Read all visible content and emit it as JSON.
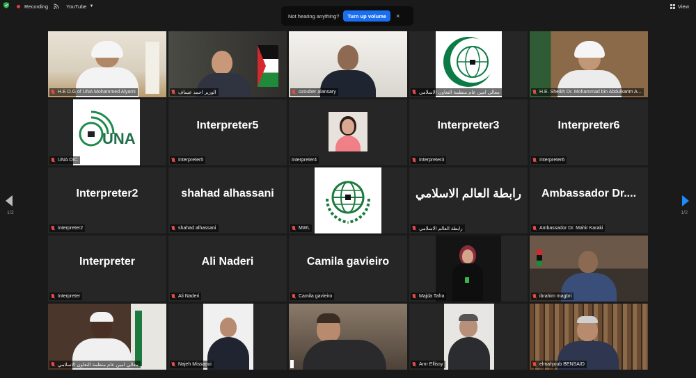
{
  "toolbar": {
    "recording_label": "Recording",
    "stream_label": "YouTube",
    "view_label": "View"
  },
  "notice": {
    "text": "Not hearing anything?",
    "button_label": "Turn up volume",
    "close_symbol": "×"
  },
  "participants": [
    {
      "name": "H.E D.G of UNA Mohammed Alyami",
      "display": ""
    },
    {
      "name": "الوزير احمد عساف",
      "display": ""
    },
    {
      "name": "ozouber alansary",
      "display": ""
    },
    {
      "name": "معالي امين عام منظمة التعاون الاسلامي",
      "display": ""
    },
    {
      "name": "H.E. Sheikh Dr. Mohammad bin Abdulkarim A...",
      "display": ""
    },
    {
      "name": "UNA OIC",
      "display": ""
    },
    {
      "name": "Interpreter5",
      "display": "Interpreter5"
    },
    {
      "name": "Interpreter4",
      "display": ""
    },
    {
      "name": "Interpreter3",
      "display": "Interpreter3"
    },
    {
      "name": "Interpreter6",
      "display": "Interpreter6"
    },
    {
      "name": "Interpreter2",
      "display": "Interpreter2"
    },
    {
      "name": "shahad alhassani",
      "display": "shahad alhassani"
    },
    {
      "name": "MWL",
      "display": ""
    },
    {
      "name": "رابطة العالم الاسلامي",
      "display": "رابطة العالم الاسلامي"
    },
    {
      "name": "Ambassador  Dr. Mahir Karaki",
      "display": "Ambassador  Dr...."
    },
    {
      "name": "Interpreter",
      "display": "Interpreter"
    },
    {
      "name": "Ali Naderi",
      "display": "Ali Naderi"
    },
    {
      "name": "Camila gavieiro",
      "display": "Camila gavieiro"
    },
    {
      "name": "Majda Tafra",
      "display": ""
    },
    {
      "name": "ibrahim magbri",
      "display": ""
    },
    {
      "name": "معالي امين عام منظمة التعاون الاسلامي",
      "display": ""
    },
    {
      "name": "Najeh Missaoui",
      "display": ""
    },
    {
      "name": "",
      "display": ""
    },
    {
      "name": "Amr Ellissy",
      "display": ""
    },
    {
      "name": "elmahjoub BENSAID",
      "display": ""
    }
  ],
  "logo_una": {
    "text": "UNA"
  },
  "pagination": {
    "left": "1/2",
    "right": "1/2"
  },
  "colors": {
    "active_speaker": "#b7d94a",
    "muted_mic": "#e34b4b",
    "turn_up_button": "#1a6ff0",
    "next_arrow": "#1a8cff"
  }
}
